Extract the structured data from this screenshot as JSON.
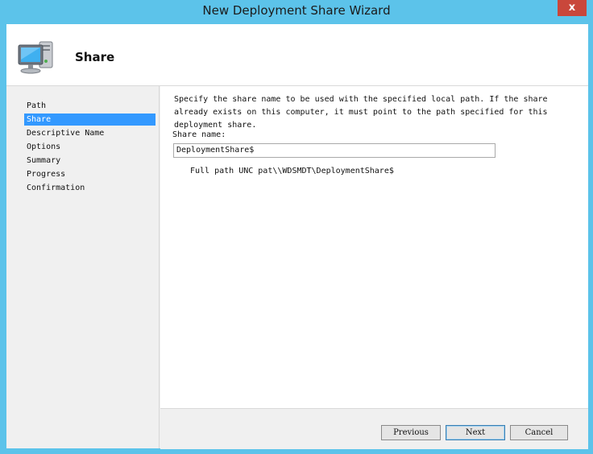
{
  "window": {
    "title": "New Deployment Share Wizard",
    "close_glyph": "x"
  },
  "header": {
    "title": "Share",
    "icon": "computer-icon"
  },
  "nav": {
    "items": [
      {
        "label": "Path",
        "active": false
      },
      {
        "label": "Share",
        "active": true
      },
      {
        "label": "Descriptive Name",
        "active": false
      },
      {
        "label": "Options",
        "active": false
      },
      {
        "label": "Summary",
        "active": false
      },
      {
        "label": "Progress",
        "active": false
      },
      {
        "label": "Confirmation",
        "active": false
      }
    ]
  },
  "content": {
    "description": "Specify the share name to be used with the specified local path.  If the share\nalready exists on this computer, it must point to the path specified for this\ndeployment share.",
    "share_label": "Share name:",
    "share_value": "DeploymentShare$",
    "unc_label": "Full path UNC pat",
    "unc_value": "\\\\WDSMDT\\DeploymentShare$"
  },
  "footer": {
    "previous_label": "Previous",
    "next_label": "Next",
    "cancel_label": "Cancel"
  },
  "colors": {
    "titlebar": "#5cc3ea",
    "selection": "#3399ff",
    "close": "#c9473b"
  }
}
